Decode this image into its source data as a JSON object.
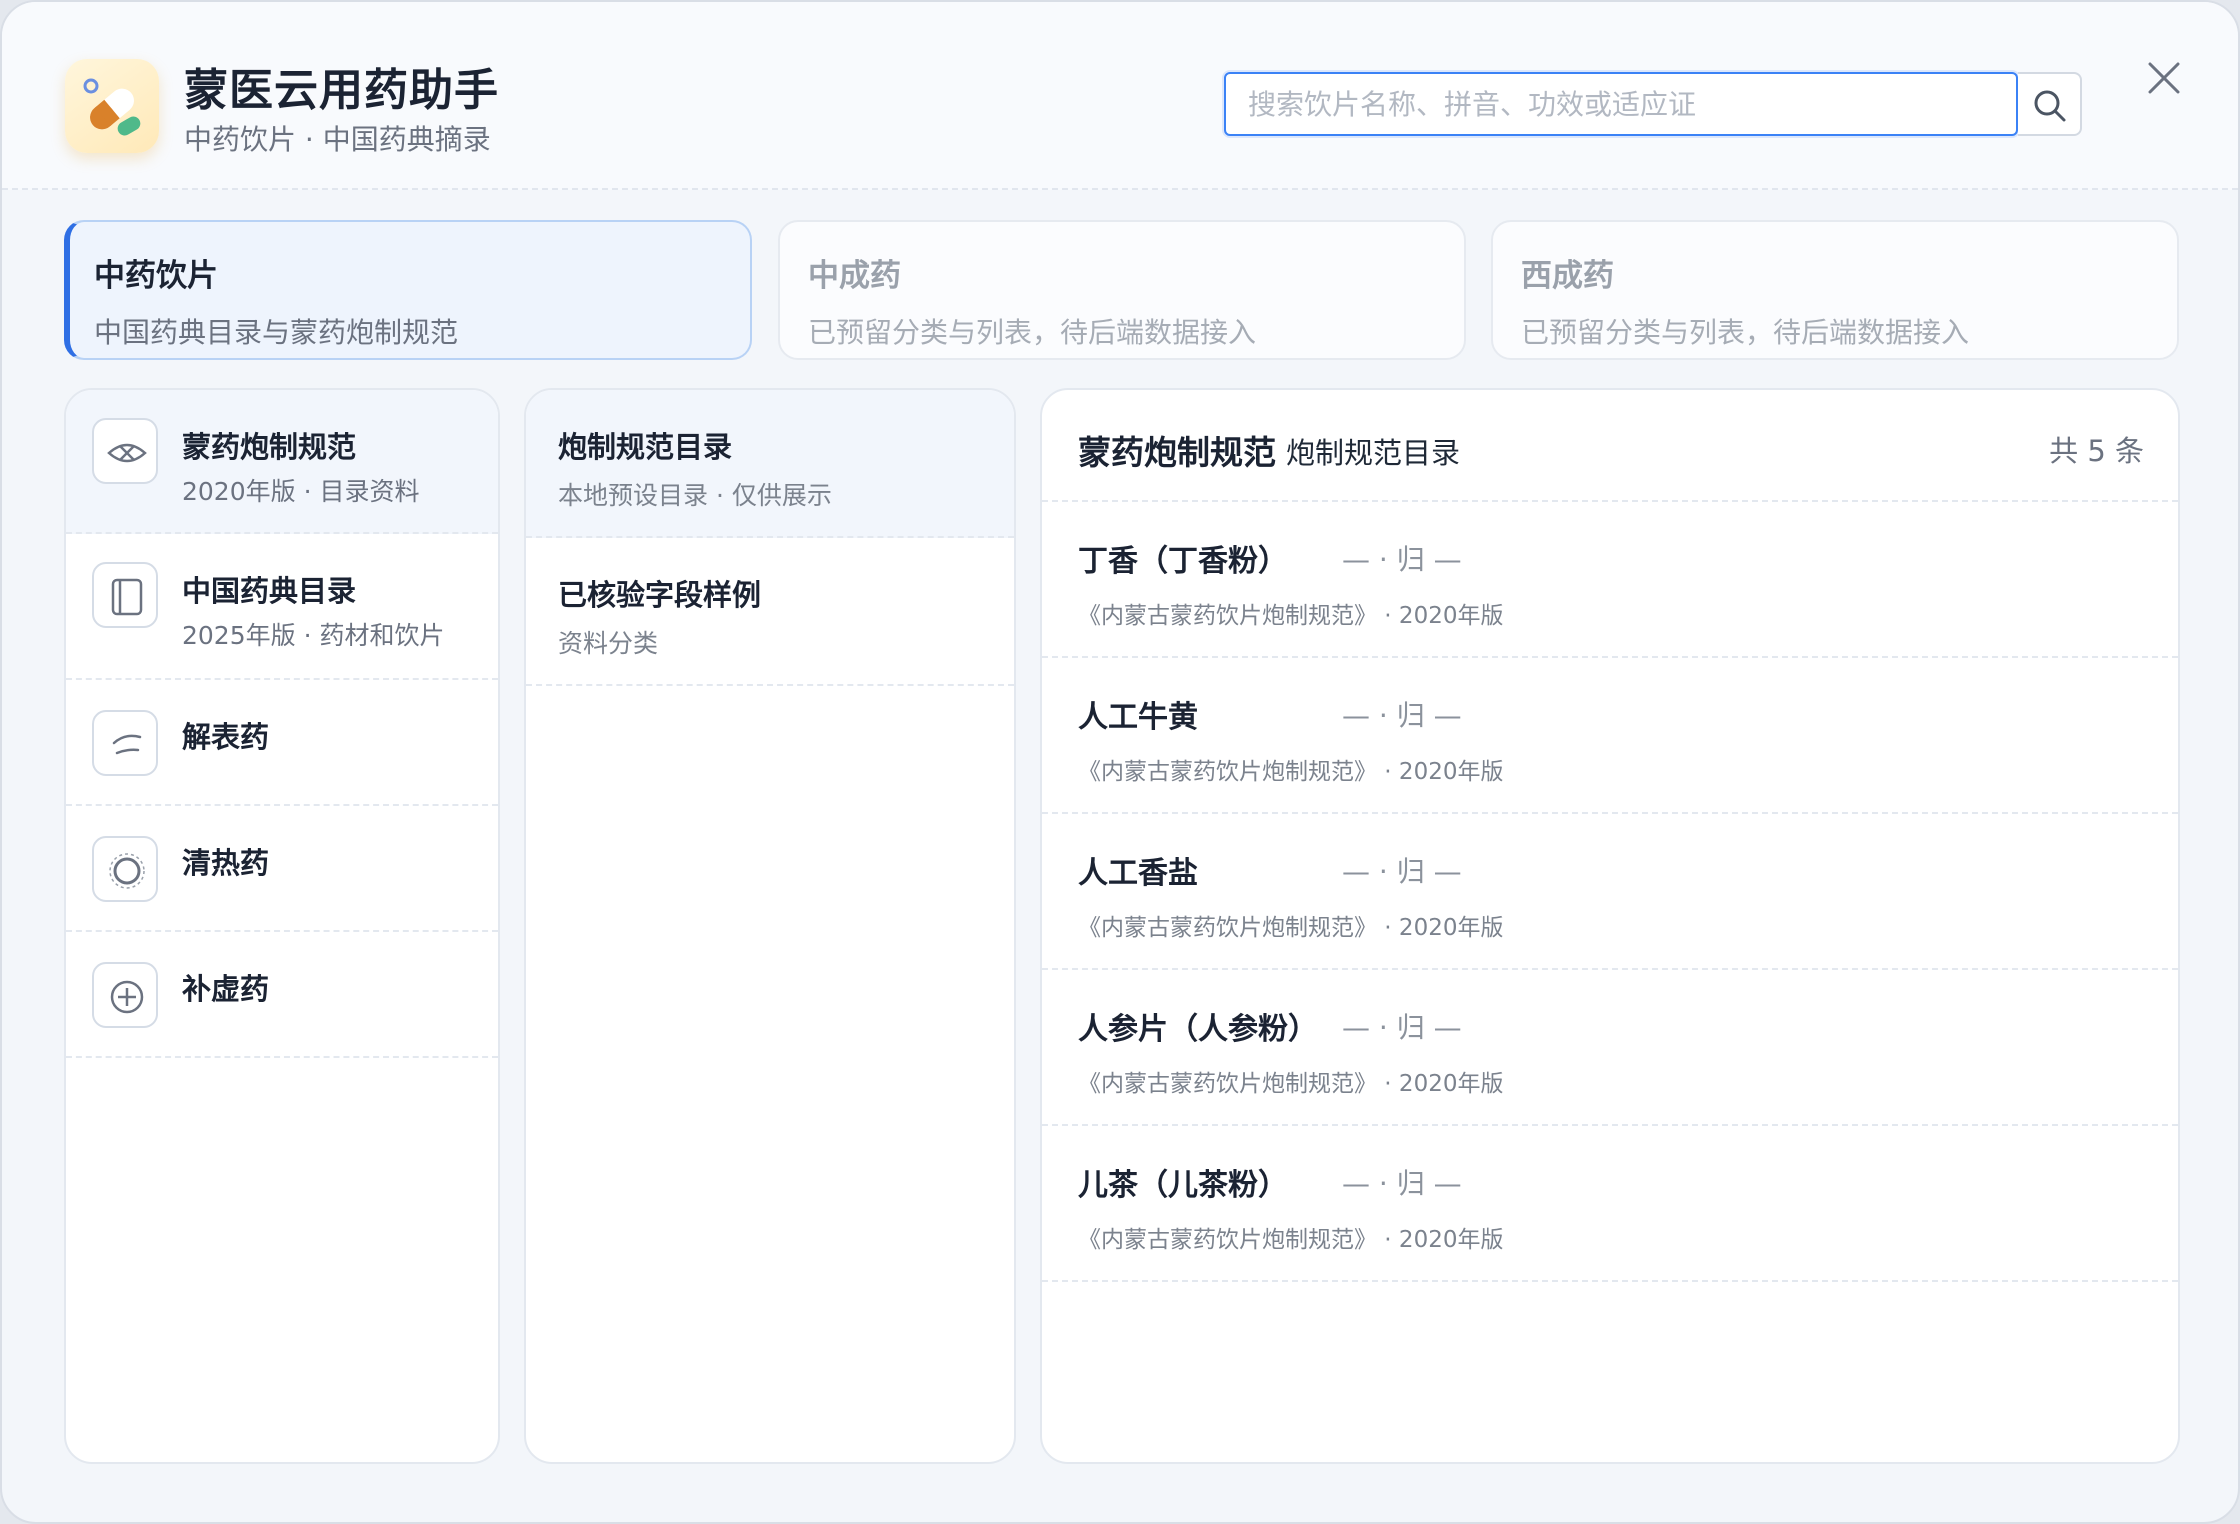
{
  "header": {
    "title": "蒙医云用药助手",
    "subtitle": "中药饮片 · 中国药典摘录",
    "app_icon": "pill-capsule-icon",
    "search_placeholder": "搜索饮片名称、拼音、功效或适应证",
    "search_icon": "search-icon",
    "close_icon": "close-icon"
  },
  "categories": [
    {
      "title": "中药饮片",
      "desc": "中国药典目录与蒙药炮制规范",
      "active": true
    },
    {
      "title": "中成药",
      "desc": "已预留分类与列表，待后端数据接入",
      "active": false
    },
    {
      "title": "西成药",
      "desc": "已预留分类与列表，待后端数据接入",
      "active": false
    }
  ],
  "left_nav": [
    {
      "title": "蒙药炮制规范",
      "sub": "2020年版 · 目录资料",
      "icon": "eye-cross-icon",
      "active": true
    },
    {
      "title": "中国药典目录",
      "sub": "2025年版 · 药材和饮片",
      "icon": "book-icon",
      "active": false
    },
    {
      "title": "解表药",
      "sub": "",
      "icon": "wind-icon",
      "active": false
    },
    {
      "title": "清热药",
      "sub": "",
      "icon": "circle-icon",
      "active": false
    },
    {
      "title": "补虚药",
      "sub": "",
      "icon": "plus-circle-icon",
      "active": false
    }
  ],
  "middle_nav": [
    {
      "title": "炮制规范目录",
      "sub": "本地预设目录 · 仅供展示",
      "active": true
    },
    {
      "title": "已核验字段样例",
      "sub": "资料分类",
      "active": false
    }
  ],
  "list": {
    "title": "蒙药炮制规范",
    "subtitle": "炮制规范目录",
    "count": "共 5 条",
    "items": [
      {
        "name": "丁香（丁香粉）",
        "attr": "— · 归 —",
        "source": "《内蒙古蒙药饮片炮制规范》 · 2020年版"
      },
      {
        "name": "人工牛黄",
        "attr": "— · 归 —",
        "source": "《内蒙古蒙药饮片炮制规范》 · 2020年版"
      },
      {
        "name": "人工香盐",
        "attr": "— · 归 —",
        "source": "《内蒙古蒙药饮片炮制规范》 · 2020年版"
      },
      {
        "name": "人参片（人参粉）",
        "attr": "— · 归 —",
        "source": "《内蒙古蒙药饮片炮制规范》 · 2020年版"
      },
      {
        "name": "儿茶（儿茶粉）",
        "attr": "— · 归 —",
        "source": "《内蒙古蒙药饮片炮制规范》 · 2020年版"
      }
    ]
  },
  "colors": {
    "accent": "#2f6fe4",
    "text_primary": "#1b2333",
    "text_secondary": "#6b7280"
  }
}
